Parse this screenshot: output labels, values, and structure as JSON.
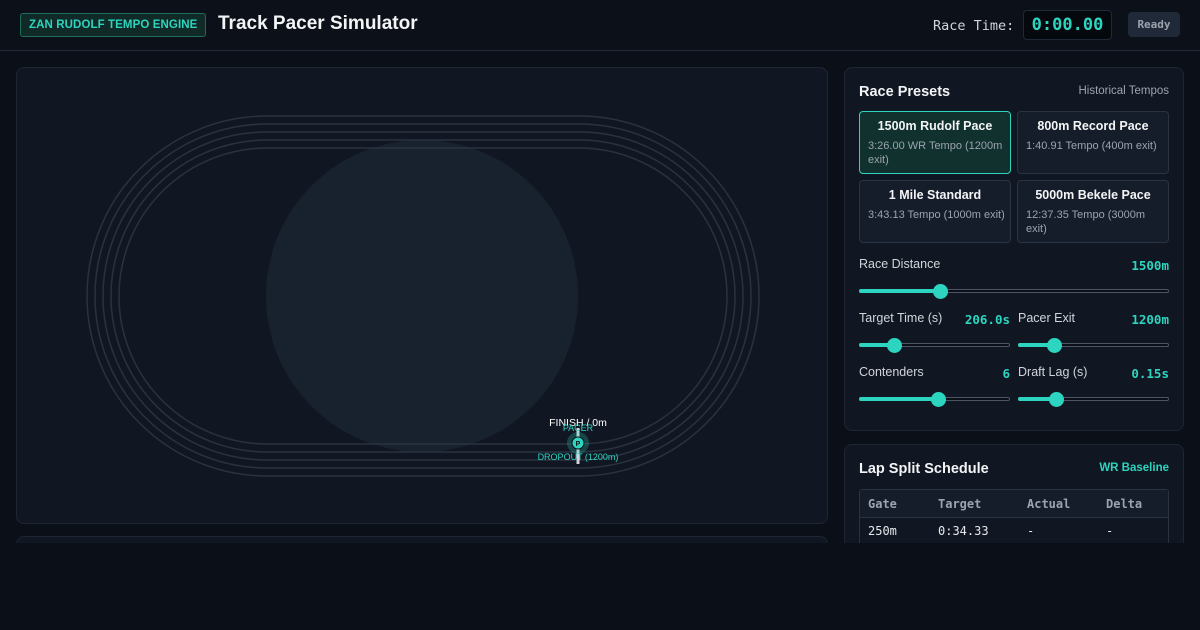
{
  "header": {
    "brand": "ZAN RUDOLF TEMPO ENGINE",
    "title": "Track Pacer Simulator",
    "race_time_label": "Race Time:",
    "race_time_value": "0:00.00",
    "status": "Ready"
  },
  "track": {
    "finish_label": "FINISH / 0m",
    "pacer_label": "PACER",
    "pacer_marker": "P",
    "dropout_label": "DROPOUT (1200m)"
  },
  "presets": {
    "title": "Race Presets",
    "subtitle": "Historical Tempos",
    "cards": [
      {
        "name": "1500m Rudolf Pace",
        "desc": "3:26.00 WR Tempo (1200m exit)",
        "active": true
      },
      {
        "name": "800m Record Pace",
        "desc": "1:40.91 Tempo (400m exit)",
        "active": false
      },
      {
        "name": "1 Mile Standard",
        "desc": "3:43.13 Tempo (1000m exit)",
        "active": false
      },
      {
        "name": "5000m Bekele Pace",
        "desc": "12:37.35 Tempo (3000m exit)",
        "active": false
      }
    ]
  },
  "controls": {
    "race_distance": {
      "label": "Race Distance",
      "value": "1500m",
      "level": 0.26
    },
    "target_time": {
      "label": "Target Time (s)",
      "value": "206.0s",
      "level": 0.23
    },
    "pacer_exit": {
      "label": "Pacer Exit",
      "value": "1200m",
      "level": 0.24
    },
    "contenders": {
      "label": "Contenders",
      "value": "6",
      "level": 0.52
    },
    "draft_lag": {
      "label": "Draft Lag (s)",
      "value": "0.15s",
      "level": 0.25
    }
  },
  "splits": {
    "title": "Lap Split Schedule",
    "badge": "WR Baseline",
    "headers": [
      "Gate",
      "Target",
      "Actual",
      "Delta"
    ],
    "rows": [
      [
        "250m",
        "0:34.33",
        "-",
        "-"
      ]
    ]
  },
  "colors": {
    "accent": "#2dd4bf",
    "background": "#0b0f17",
    "panel": "#111722"
  }
}
